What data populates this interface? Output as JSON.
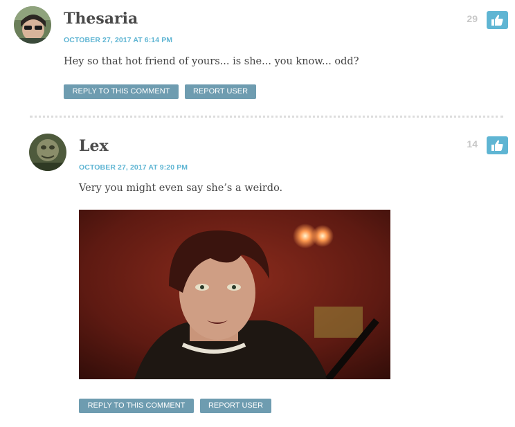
{
  "comments": [
    {
      "author": "Thesaria",
      "date": "OCTOBER 27, 2017 AT 6:14 PM",
      "text": "Hey so that hot friend of yours... is she... you know... odd?",
      "likes": "29",
      "reply_label": "REPLY TO THIS COMMENT",
      "report_label": "REPORT USER"
    },
    {
      "author": "Lex",
      "date": "OCTOBER 27, 2017 AT 9:20 PM",
      "text": "Very you might even say she’s a weirdo.",
      "likes": "14",
      "reply_label": "REPLY TO THIS COMMENT",
      "report_label": "REPORT USER"
    }
  ],
  "icons": {
    "like": "thumbs-up-icon"
  },
  "colors": {
    "accent": "#5fb5d3",
    "button": "#6e9cb0",
    "count": "#c7c7c7"
  }
}
